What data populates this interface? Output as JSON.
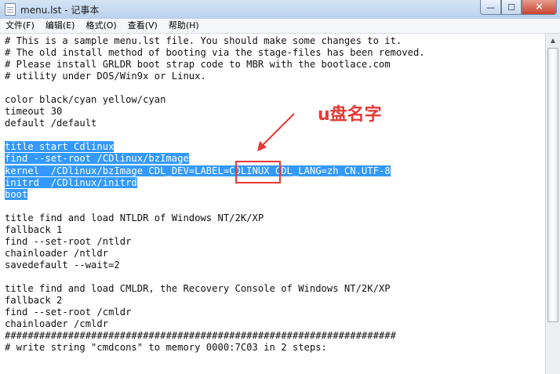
{
  "window": {
    "title": "menu.lst - 记事本",
    "minimize_glyph": "—",
    "maximize_glyph": "☐",
    "close_glyph": "✕"
  },
  "menu": [
    "文件(F)",
    "编辑(E)",
    "格式(O)",
    "查看(V)",
    "帮助(H)"
  ],
  "editor": {
    "lines": [
      {
        "text": "# This is a sample menu.lst file. You should make some changes to it.",
        "selected": false
      },
      {
        "text": "# The old install method of booting via the stage-files has been removed.",
        "selected": false
      },
      {
        "text": "# Please install GRLDR boot strap code to MBR with the bootlace.com",
        "selected": false
      },
      {
        "text": "# utility under DOS/Win9x or Linux.",
        "selected": false
      },
      {
        "text": "",
        "selected": false
      },
      {
        "text": "color black/cyan yellow/cyan",
        "selected": false
      },
      {
        "text": "timeout 30",
        "selected": false
      },
      {
        "text": "default /default",
        "selected": false
      },
      {
        "text": "",
        "selected": false
      },
      {
        "text": "title start Cdlinux",
        "selected": true
      },
      {
        "text": "find --set-root /CDlinux/bzImage",
        "selected": true
      },
      {
        "text": "kernel  /CDlinux/bzImage CDL_DEV=LABEL=CDLINUX CDL_LANG=zh_CN.UTF-8",
        "selected": true
      },
      {
        "text": "initrd  /CDlinux/initrd",
        "selected": true
      },
      {
        "text": "boot",
        "selected": true
      },
      {
        "text": "",
        "selected": false
      },
      {
        "text": "title find and load NTLDR of Windows NT/2K/XP",
        "selected": false
      },
      {
        "text": "fallback 1",
        "selected": false
      },
      {
        "text": "find --set-root /ntldr",
        "selected": false
      },
      {
        "text": "chainloader /ntldr",
        "selected": false
      },
      {
        "text": "savedefault --wait=2",
        "selected": false
      },
      {
        "text": "",
        "selected": false
      },
      {
        "text": "title find and load CMLDR, the Recovery Console of Windows NT/2K/XP",
        "selected": false
      },
      {
        "text": "fallback 2",
        "selected": false
      },
      {
        "text": "find --set-root /cmldr",
        "selected": false
      },
      {
        "text": "chainloader /cmldr",
        "selected": false
      },
      {
        "text": "####################################################################",
        "selected": false
      },
      {
        "text": "# write string \"cmdcons\" to memory 0000:7C03 in 2 steps:",
        "selected": false
      }
    ]
  },
  "annotation": {
    "label": "u盘名字",
    "color": "#e53935"
  },
  "scrollbar": {
    "up_glyph": "▲"
  },
  "selection_color": "#3399ff"
}
